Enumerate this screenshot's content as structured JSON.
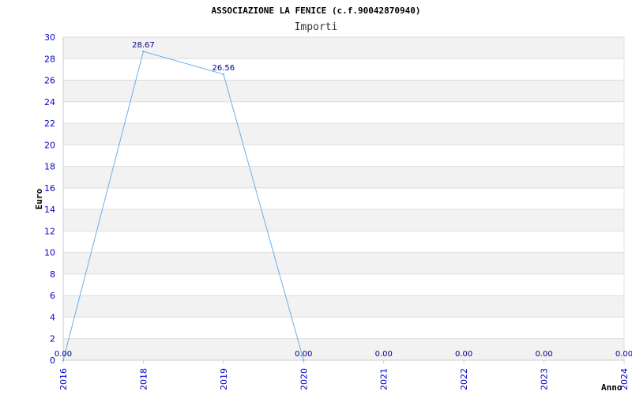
{
  "chart_data": {
    "type": "line",
    "title": "ASSOCIAZIONE LA FENICE (c.f.90042870940)",
    "subtitle": "Importi",
    "xlabel": "Anno",
    "ylabel": "Euro",
    "categories": [
      "2016",
      "2018",
      "2019",
      "2020",
      "2021",
      "2022",
      "2023",
      "2024"
    ],
    "series": [
      {
        "values": [
          0,
          28.67,
          26.56,
          0,
          null,
          null,
          null,
          null
        ]
      }
    ],
    "data_labels": [
      "0.00",
      "28.67",
      "26.56",
      "0.00",
      "0.00",
      "0.00",
      "0.00",
      "0.00"
    ],
    "y_ticks": [
      "0",
      "2",
      "4",
      "6",
      "8",
      "10",
      "12",
      "14",
      "16",
      "18",
      "20",
      "22",
      "24",
      "26",
      "28",
      "30"
    ],
    "ylim": [
      0,
      30
    ],
    "grid": true,
    "colors": {
      "line": "#6aaef0",
      "band": "#f2f2f2",
      "grid": "#dddddd",
      "tick": "#0000cc",
      "data_label": "#000080"
    }
  }
}
